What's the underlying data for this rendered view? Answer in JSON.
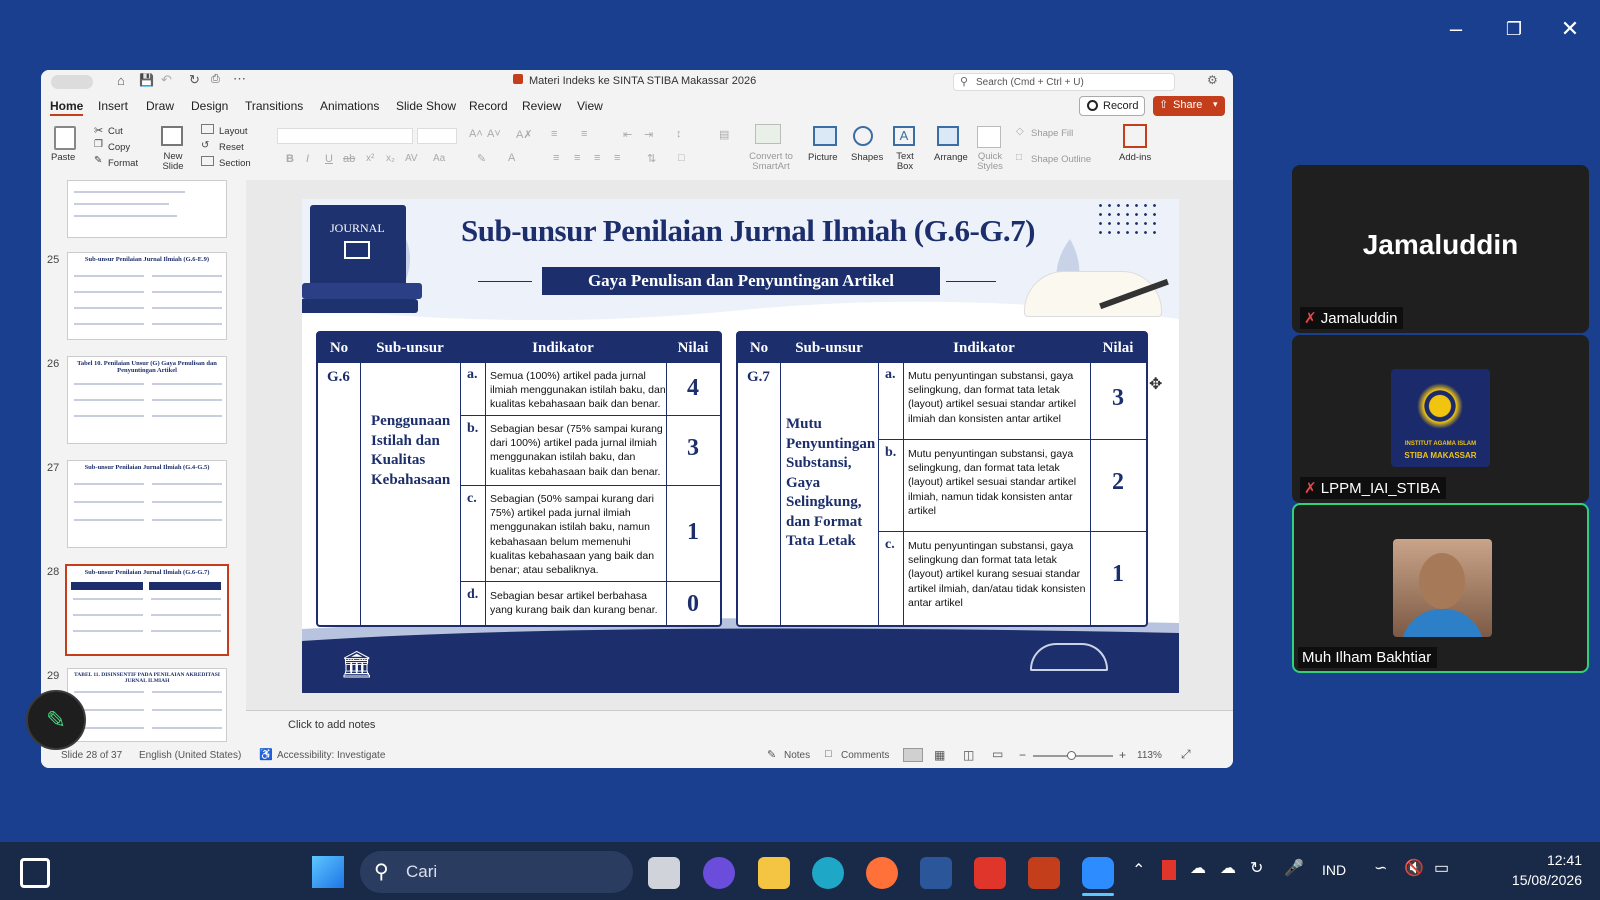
{
  "ppt": {
    "doc_title": "Materi Indeks ke SINTA STIBA Makassar 2026",
    "search_placeholder": "Search (Cmd + Ctrl + U)",
    "menu": [
      "Home",
      "Insert",
      "Draw",
      "Design",
      "Transitions",
      "Animations",
      "Slide Show",
      "Record",
      "Review",
      "View"
    ],
    "record_btn": "Record",
    "share_btn": "Share",
    "ribbon": {
      "paste": "Paste",
      "cut": "Cut",
      "copy": "Copy",
      "format": "Format",
      "new_slide": "New Slide",
      "layout": "Layout",
      "reset": "Reset",
      "section": "Section",
      "convert_smartart": "Convert to SmartArt",
      "picture": "Picture",
      "shapes": "Shapes",
      "text_box": "Text Box",
      "arrange": "Arrange",
      "quick_styles": "Quick Styles",
      "shape_fill": "Shape Fill",
      "shape_outline": "Shape Outline",
      "addins": "Add-ins"
    },
    "thumbs": [
      {
        "num": "",
        "title": ""
      },
      {
        "num": "25",
        "title": "Sub-unsur Penilaian Jurnal Ilmiah (G.6-E.9)"
      },
      {
        "num": "26",
        "title": "Tabel 10. Penilaian Unsur (G) Gaya Penulisan dan Penyuntingan Artikel"
      },
      {
        "num": "27",
        "title": "Sub-unsur Penilaian Jurnal Ilmiah (G.4-G.5)"
      },
      {
        "num": "28",
        "title": "Sub-unsur Penilaian Jurnal Ilmiah (G.6-G.7)"
      },
      {
        "num": "29",
        "title": "TABEL 11. DISINSENTIF PADA PENILAIAN AKREDITASI JURNAL ILMIAH"
      }
    ],
    "notes_placeholder": "Click to add notes",
    "status": {
      "slide_of": "Slide 28 of 37",
      "language": "English (United States)",
      "accessibility": "Accessibility: Investigate",
      "notes": "Notes",
      "comments": "Comments",
      "zoom": "113%"
    }
  },
  "slide": {
    "badge": "JOURNAL",
    "title": "Sub-unsur Penilaian Jurnal Ilmiah (G.6-G.7)",
    "subtitle": "Gaya Penulisan dan Penyuntingan Artikel",
    "headers": [
      "No",
      "Sub-unsur",
      "Indikator",
      "Nilai"
    ],
    "left": {
      "no": "G.6",
      "sub": "Penggunaan Istilah dan Kualitas Kebahasaan",
      "rows": [
        {
          "letter": "a.",
          "text": "Semua (100%) artikel pada jurnal ilmiah menggunakan istilah baku, dan kualitas kebahasaan baik dan benar.",
          "value": "4"
        },
        {
          "letter": "b.",
          "text": "Sebagian besar (75% sampai kurang dari 100%) artikel pada jurnal ilmiah menggunakan istilah baku, dan kualitas kebahasaan baik dan benar.",
          "value": "3"
        },
        {
          "letter": "c.",
          "text": "Sebagian (50% sampai kurang dari 75%) artikel pada jurnal ilmiah menggunakan istilah baku, namun kebahasaan belum memenuhi kualitas kebahasaan yang baik dan benar; atau sebaliknya.",
          "value": "1"
        },
        {
          "letter": "d.",
          "text": "Sebagian besar artikel berbahasa yang kurang baik dan kurang benar.",
          "value": "0"
        }
      ]
    },
    "right": {
      "no": "G.7",
      "sub": "Mutu Penyuntingan Substansi, Gaya Selingkung, dan Format Tata Letak",
      "rows": [
        {
          "letter": "a.",
          "text": "Mutu penyuntingan substansi, gaya selingkung, dan format tata letak (layout) artikel sesuai standar artikel ilmiah dan konsisten antar artikel",
          "value": "3"
        },
        {
          "letter": "b.",
          "text": "Mutu penyuntingan substansi, gaya selingkung, dan format tata letak (layout) artikel sesuai standar artikel ilmiah, namun tidak konsisten antar artikel",
          "value": "2"
        },
        {
          "letter": "c.",
          "text": "Mutu penyuntingan substansi, gaya selingkung dan format tata letak (layout) artikel kurang sesuai standar artikel ilmiah, dan/atau tidak konsisten antar artikel",
          "value": "1"
        }
      ]
    }
  },
  "zoom": {
    "speaker": "Jamaluddin",
    "participants": [
      {
        "name": "Jamaluddin",
        "muted": true
      },
      {
        "name": "LPPM_IAI_STIBA",
        "muted": true
      },
      {
        "name": "Muh Ilham Bakhtiar",
        "muted": false
      }
    ],
    "logo_text": [
      "INSTITUT AGAMA ISLAM",
      "STIBA MAKASSAR"
    ]
  },
  "taskbar": {
    "search": "Cari",
    "lang": "IND",
    "time": "12:41",
    "date": "15/08/2026"
  }
}
